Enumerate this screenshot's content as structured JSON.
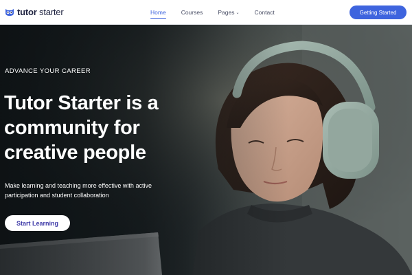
{
  "brand": {
    "name_bold": "tutor",
    "name_light": " starter"
  },
  "nav": {
    "items": [
      {
        "label": "Home"
      },
      {
        "label": "Courses"
      },
      {
        "label": "Pages"
      },
      {
        "label": "Contact"
      }
    ],
    "cta_label": "Getting Started"
  },
  "hero": {
    "eyebrow": "ADVANCE YOUR CAREER",
    "headline_line1": "Tutor Starter is a",
    "headline_line2": "community for",
    "headline_line3": "creative people",
    "subtext_line1": "Make learning and teaching more effective with active",
    "subtext_line2": "participation and student collaboration",
    "button_label": "Start Learning"
  },
  "colors": {
    "accent": "#3e64de",
    "nav_text": "#4a4f66",
    "button_text": "#3e3aa8",
    "logo_text": "#1f2340"
  },
  "icons": {
    "logo": "owl-logo-icon",
    "pages_dropdown": "chevron-down-icon"
  }
}
